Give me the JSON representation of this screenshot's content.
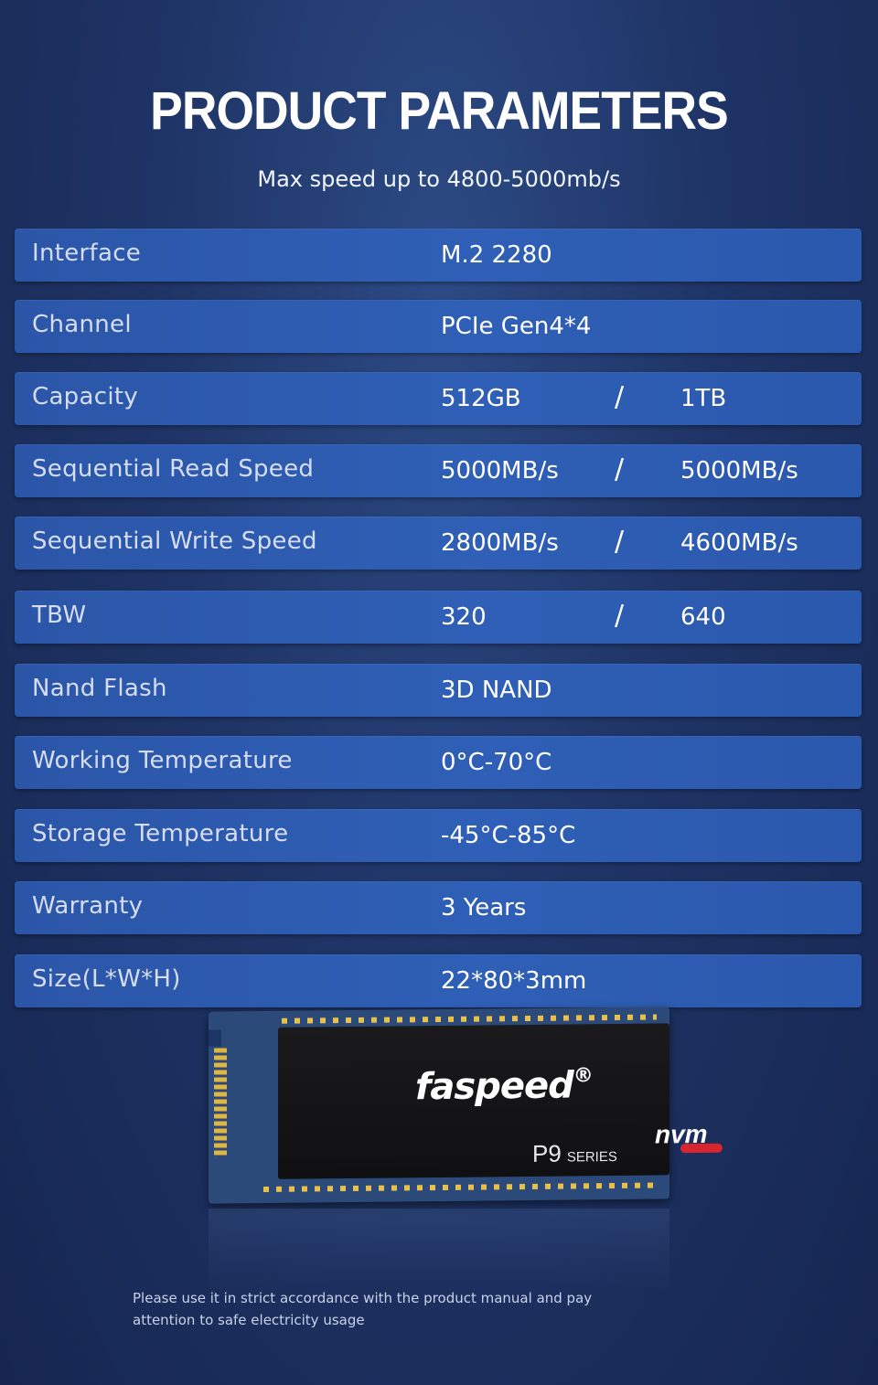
{
  "header": {
    "title": "PRODUCT PARAMETERS",
    "subtitle": "Max speed up to 4800-5000mb/s"
  },
  "params": [
    {
      "label": "Interface",
      "v1": "M.2 2280"
    },
    {
      "label": "Channel",
      "v1": "PCIe Gen4*4"
    },
    {
      "label": "Capacity",
      "v1": "512GB",
      "sep": "/",
      "v2": "1TB"
    },
    {
      "label": "Sequential Read Speed",
      "v1": "5000MB/s",
      "sep": "/",
      "v2": "5000MB/s"
    },
    {
      "label": "Sequential Write Speed",
      "v1": "2800MB/s",
      "sep": "/",
      "v2": "4600MB/s"
    },
    {
      "label": "TBW",
      "v1": "320",
      "sep": "/",
      "v2": "640"
    },
    {
      "label": "Nand Flash",
      "v1": "3D NAND"
    },
    {
      "label": "Working Temperature",
      "v1": "0°C-70°C"
    },
    {
      "label": "Storage Temperature",
      "v1": "-45°C-85°C"
    },
    {
      "label": "Warranty",
      "v1": "3 Years"
    },
    {
      "label": "Size(L*W*H)",
      "v1": "22*80*3mm"
    }
  ],
  "product": {
    "brand": "faspeed",
    "registered": "®",
    "series": "P9",
    "series_suffix": "SERIES",
    "nvm": "nvm"
  },
  "notice": "Please use it in strict accordance with the product manual and pay attention to safe electricity usage"
}
